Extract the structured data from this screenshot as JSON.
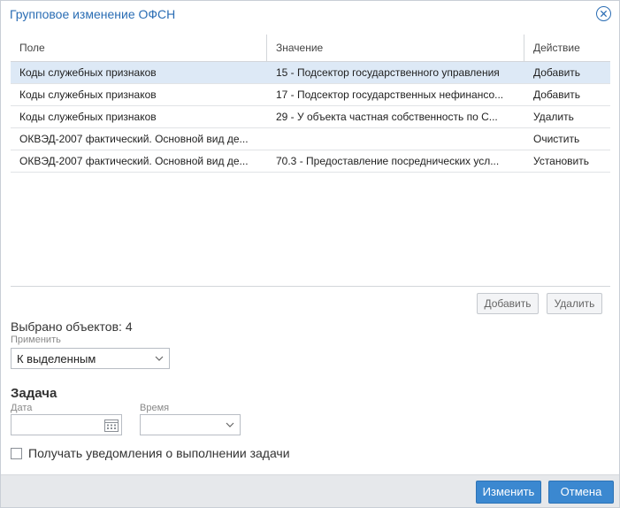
{
  "dialog": {
    "title": "Групповое изменение ОФСН"
  },
  "grid": {
    "columns": [
      "Поле",
      "Значение",
      "Действие"
    ],
    "rows": [
      {
        "field": "Коды служебных признаков",
        "value": "15 - Подсектор государственного управления",
        "action": "Добавить",
        "selected": true
      },
      {
        "field": "Коды служебных признаков",
        "value": "17 - Подсектор государственных нефинансо...",
        "action": "Добавить",
        "selected": false
      },
      {
        "field": "Коды служебных признаков",
        "value": "29 - У объекта частная собственность по С...",
        "action": "Удалить",
        "selected": false
      },
      {
        "field": "ОКВЭД-2007 фактический. Основной вид де...",
        "value": "",
        "action": "Очистить",
        "selected": false
      },
      {
        "field": "ОКВЭД-2007 фактический. Основной вид де...",
        "value": "70.3 - Предоставление посреднических усл...",
        "action": "Установить",
        "selected": false
      }
    ]
  },
  "grid_buttons": {
    "add_label": "Добавить",
    "delete_label": "Удалить"
  },
  "selection": {
    "count_text": "Выбрано объектов: 4",
    "apply_label": "Применить",
    "apply_value": "К выделенным"
  },
  "task": {
    "title": "Задача",
    "date_label": "Дата",
    "date_value": "",
    "time_label": "Время",
    "time_value": ""
  },
  "notify": {
    "label": "Получать уведомления о выполнении задачи",
    "checked": false
  },
  "footer": {
    "apply_label": "Изменить",
    "cancel_label": "Отмена"
  },
  "colors": {
    "accent": "#3b88d0",
    "title": "#2a6db4",
    "selected_row": "#dde9f6"
  }
}
